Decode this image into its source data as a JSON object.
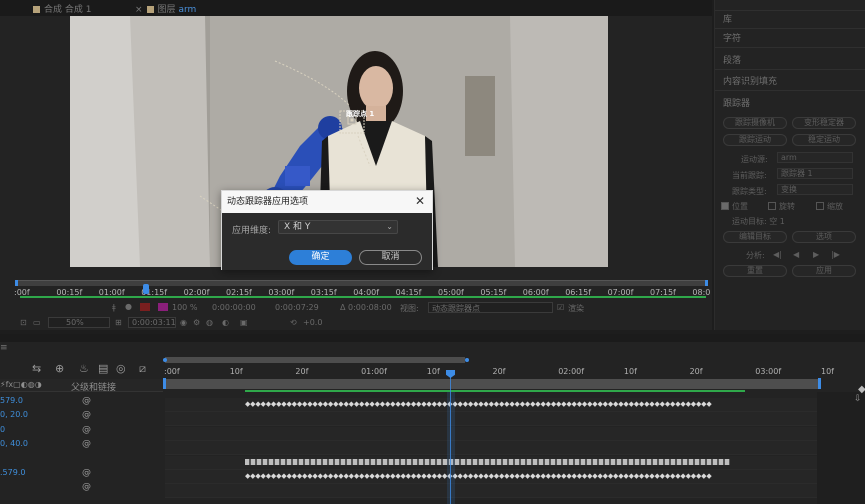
{
  "viewer": {
    "tabs": [
      {
        "label": "合成 合成 1"
      },
      {
        "label": "图层",
        "active_label": "arm"
      }
    ],
    "tab_close": "×",
    "tracker_label": "跟踪点 1",
    "timeline_labels": [
      ":00f",
      "00:15f",
      "01:00f",
      "01:15f",
      "02:00f",
      "02:15f",
      "03:00f",
      "03:15f",
      "04:00f",
      "04:15f",
      "05:00f",
      "05:15f",
      "06:00f",
      "06:15f",
      "07:00f",
      "07:15f",
      "08:0"
    ],
    "toolbar1": {
      "time_current": "0:00:00:00",
      "time_end": "0:00:07:29",
      "duration": "Δ 0:00:08:00",
      "view_label": "视图:",
      "view_value": "动态跟踪器点",
      "render_label": "渲染",
      "zoom_pct": "100 %"
    },
    "toolbar2": {
      "zoom": "50%",
      "timecode": "0:00:03:11",
      "offset": "+0.0"
    }
  },
  "dialog": {
    "title": "动态跟踪器应用选项",
    "close": "✕",
    "dim_label": "应用维度:",
    "dim_value": "X 和 Y",
    "ok": "确定",
    "cancel": "取消"
  },
  "right_panel": {
    "items": [
      "库",
      "字符",
      "段落",
      "内容识别填充",
      "跟踪器"
    ],
    "buttons": {
      "track_camera": "跟踪摄像机",
      "warp_stabilize": "变形稳定器",
      "track_motion": "跟踪运动",
      "stabilize_motion": "稳定运动",
      "edit_target": "编辑目标",
      "options": "选项",
      "reset": "重置",
      "apply": "应用"
    },
    "motion_source_label": "运动源:",
    "motion_source_value": "arm",
    "current_track_label": "当前跟踪:",
    "current_track_value": "跟踪器 1",
    "track_type_label": "跟踪类型:",
    "track_type_value": "变换",
    "position": "位置",
    "rotation": "旋转",
    "scale": "缩放",
    "motion_target": "运动目标: 空 1",
    "analyze_label": "分析:",
    "analyze_controls": [
      "◀|",
      "◀",
      "▶",
      "|▶"
    ]
  },
  "timeline": {
    "ruler_labels": [
      ":00f",
      "10f",
      "20f",
      "01:00f",
      "10f",
      "20f",
      "02:00f",
      "10f",
      "20f",
      "03:00f",
      "10f"
    ],
    "col_header": "父级和链接",
    "layer_values": [
      "579.0",
      "0, 20.0",
      "0",
      "0, 40.0",
      "",
      ".579.0",
      ""
    ],
    "keyframe_glyph": "◆"
  }
}
